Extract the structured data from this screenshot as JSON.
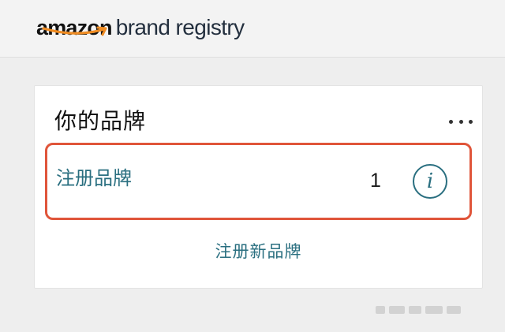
{
  "header": {
    "logo_primary": "amazon",
    "logo_secondary": "brand registry"
  },
  "card": {
    "title": "你的品牌",
    "more_icon": "more-horizontal-icon",
    "brand_row": {
      "link_label": "注册品牌",
      "count": "1",
      "info_glyph": "i",
      "info_icon": "info-circle-icon"
    },
    "register_new_label": "注册新品牌"
  },
  "colors": {
    "link": "#2a6f80",
    "highlight_border": "#e0553a",
    "header_bg": "#f3f3f3",
    "page_bg": "#eeeeee"
  }
}
